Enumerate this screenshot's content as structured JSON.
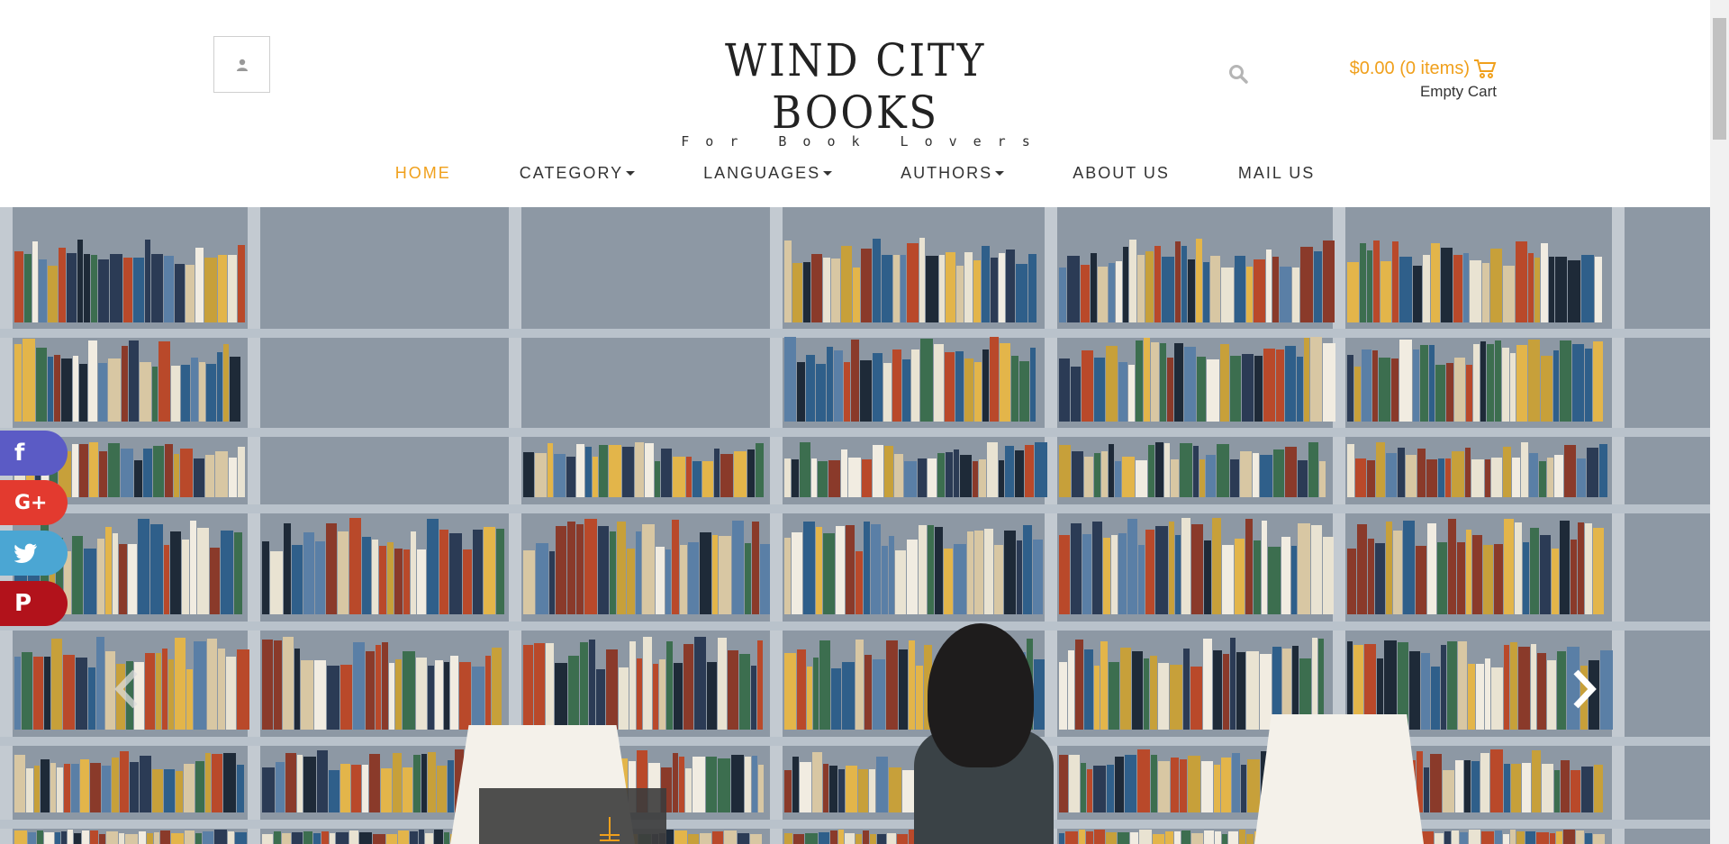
{
  "header": {
    "logo_title": "WIND CITY BOOKS",
    "logo_tagline": "For Book Lovers",
    "account_icon": "user-icon",
    "search_icon": "search-icon",
    "cart": {
      "total": "$0.00 (0 items)",
      "status": "Empty Cart",
      "icon": "cart-icon"
    }
  },
  "nav": {
    "items": [
      {
        "label": "HOME",
        "active": true
      },
      {
        "label": "CATEGORY",
        "dropdown": true
      },
      {
        "label": "LANGUAGES",
        "dropdown": true
      },
      {
        "label": "AUTHORS",
        "dropdown": true
      },
      {
        "label": "ABOUT US"
      },
      {
        "label": "MAIL US"
      }
    ]
  },
  "social": {
    "facebook": "f",
    "googleplus": "G+",
    "twitter": "twitter-icon",
    "pinterest": "P"
  },
  "carousel": {
    "prev_icon": "chevron-left-icon",
    "next_icon": "chevron-right-icon"
  },
  "colors": {
    "accent": "#f0a01c",
    "facebook": "#5b5bc5",
    "googleplus": "#e33a2f",
    "twitter": "#4ba6d3",
    "pinterest": "#b2121b"
  }
}
